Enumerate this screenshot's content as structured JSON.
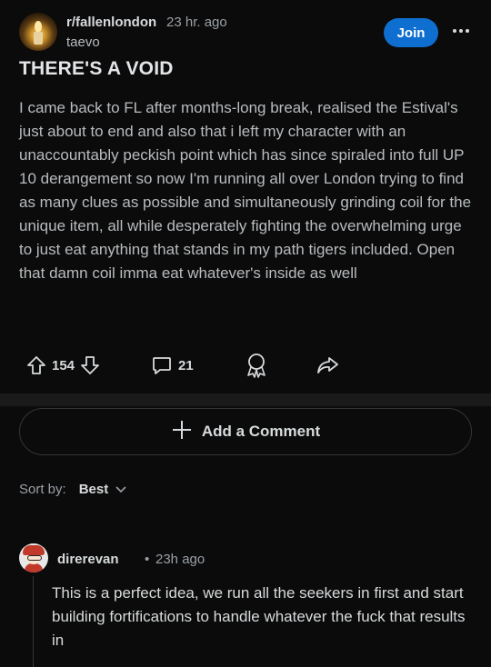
{
  "post": {
    "subreddit": "r/fallenlondon",
    "time": "23 hr. ago",
    "author": "taevo",
    "join_label": "Join",
    "title": "THERE'S A VOID",
    "body": "I came back to FL after months-long break, realised the Estival's just about to end and also that i left my character with an unaccountably peckish point which has since spiraled into full UP 10 derangement so now I'm running all over London trying to find as many clues as possible and simultaneously grinding coil for the unique item, all while desperately fighting the overwhelming urge to just eat anything that stands in my path tigers included. Open that damn coil imma eat whatever's inside as well",
    "upvotes": "154",
    "comments_count": "21"
  },
  "comment_box": {
    "label": "Add a Comment"
  },
  "sort": {
    "label": "Sort by:",
    "value": "Best"
  },
  "comments": [
    {
      "user": "direrevan",
      "separator": "•",
      "time": "23h ago",
      "body": "This is a perfect idea, we run all the seekers in first and start building fortifications to handle whatever the fuck that results in"
    }
  ],
  "colors": {
    "background": "#0b0b0b",
    "join_button": "#0f6fd0",
    "text_primary": "#d7dadc",
    "text_secondary": "#9aa0a6"
  },
  "icons": [
    "more-icon",
    "upvote-icon",
    "downvote-icon",
    "comment-icon",
    "award-icon",
    "share-icon",
    "plus-icon",
    "chevron-down-icon"
  ]
}
